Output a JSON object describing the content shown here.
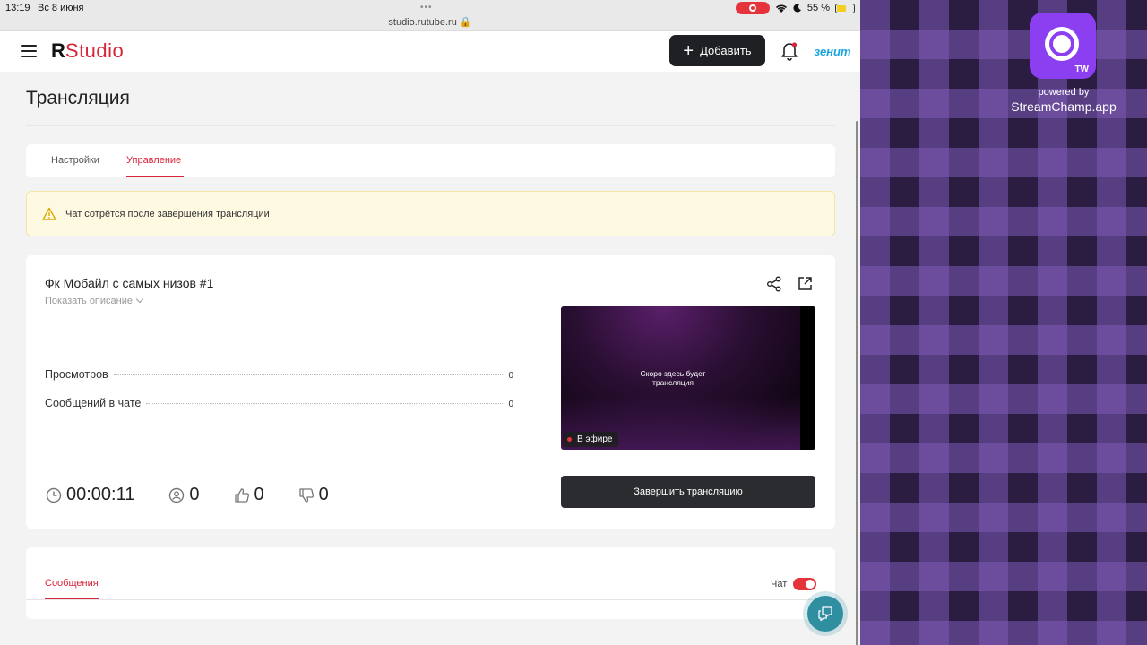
{
  "statusbar": {
    "time": "13:19",
    "date": "Вс 8 июня",
    "dots": "•••",
    "url": "studio.rutube.ru 🔒",
    "battery": "55 %"
  },
  "header": {
    "logo_r": "R",
    "logo_studio": "Studio",
    "add_label": "Добавить",
    "avatar_text": "зенит"
  },
  "page": {
    "title": "Трансляция"
  },
  "tabs": [
    {
      "label": "Настройки"
    },
    {
      "label": "Управление"
    }
  ],
  "alert": {
    "text": "Чат сотрётся после завершения трансляции"
  },
  "stream": {
    "title": "Фк Мобайл с самых низов #1",
    "show_description": "Показать описание",
    "stats": [
      {
        "label": "Просмотров",
        "value": "0"
      },
      {
        "label": "Сообщений в чате",
        "value": "0"
      }
    ],
    "timer": "00:00:11",
    "viewers": "0",
    "likes": "0",
    "dislikes": "0",
    "preview_text": "Скоро здесь будет трансляция",
    "live_label": "В эфире",
    "end_button": "Завершить трансляцию"
  },
  "messages": {
    "tab_label": "Сообщения",
    "chat_label": "Чат",
    "chat_enabled": true
  },
  "overlay": {
    "app_badge": "TW",
    "powered_by": "powered by",
    "app_name": "StreamChamp.app"
  },
  "colors": {
    "accent": "#d9243a",
    "dark_button": "#1f2023",
    "help_fab": "#2f8ea0",
    "overlay_purple": "#8b3ff1"
  }
}
